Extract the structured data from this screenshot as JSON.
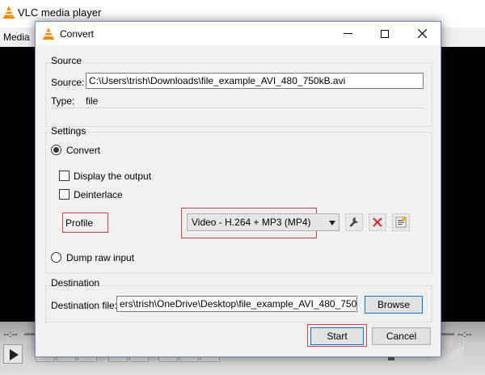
{
  "vlc": {
    "title": "VLC media player",
    "menu_media": "Media",
    "time_left": "--:--",
    "time_right": "--:--"
  },
  "dialog": {
    "title": "Convert",
    "window_buttons": {
      "minimize": "—",
      "maximize": "☐",
      "close": "✕"
    },
    "source": {
      "group_label": "Source",
      "source_label": "Source:",
      "source_value": "C:\\Users\\trish\\Downloads\\file_example_AVI_480_750kB.avi",
      "type_label": "Type:",
      "type_value": "file"
    },
    "settings": {
      "group_label": "Settings",
      "convert_label": "Convert",
      "display_output_label": "Display the output",
      "deinterlace_label": "Deinterlace",
      "profile_label": "Profile",
      "profile_selected": "Video - H.264 + MP3 (MP4)",
      "dump_raw_label": "Dump raw input"
    },
    "destination": {
      "group_label": "Destination",
      "file_label": "Destination file:",
      "file_value": "ers\\trish\\OneDrive\\Desktop\\file_example_AVI_480_750kB.avi",
      "browse_label": "Browse"
    },
    "start_label": "Start",
    "cancel_label": "Cancel"
  },
  "colors": {
    "highlight_red": "#e13b3b",
    "vlc_orange": "#f08a00",
    "delete_red": "#d32f2f"
  }
}
